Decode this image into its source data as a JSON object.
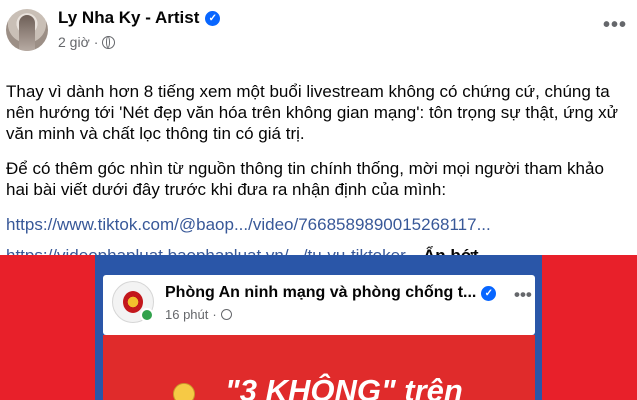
{
  "post": {
    "author": "Ly Nha Ky - Artist",
    "verified": true,
    "time": "2 giờ",
    "more_label": "•••",
    "paragraph1": "Thay vì dành hơn 8 tiếng xem một buổi livestream không có chứng cứ, chúng ta nên hướng tới 'Nét đẹp văn hóa trên không gian mạng': tôn trọng sự thật, ứng xử văn minh và chất lọc thông tin có giá trị.",
    "paragraph2": "Để có thêm góc nhìn từ nguồn thông tin chính thống, mời mọi người tham khảo hai bài viết dưới đây trước khi đưa ra nhận định của mình:",
    "link1": "https://www.tiktok.com/@baop.../video/7668589890015268117...",
    "link2": "https://videophapluat.baophapluat.vn/.../tu-vu-tiktoker...",
    "show_less": "Ẩn bớt"
  },
  "shared": {
    "page_name": "Phòng An ninh mạng và phòng chống t...",
    "time": "16 phút",
    "more_label": "•••",
    "headline": "\"3 KHÔNG\" trên"
  },
  "colors": {
    "link": "#385898",
    "verified": "#0866ff",
    "embed_bg": "#e8202a",
    "card_bg": "#2a56a8"
  }
}
